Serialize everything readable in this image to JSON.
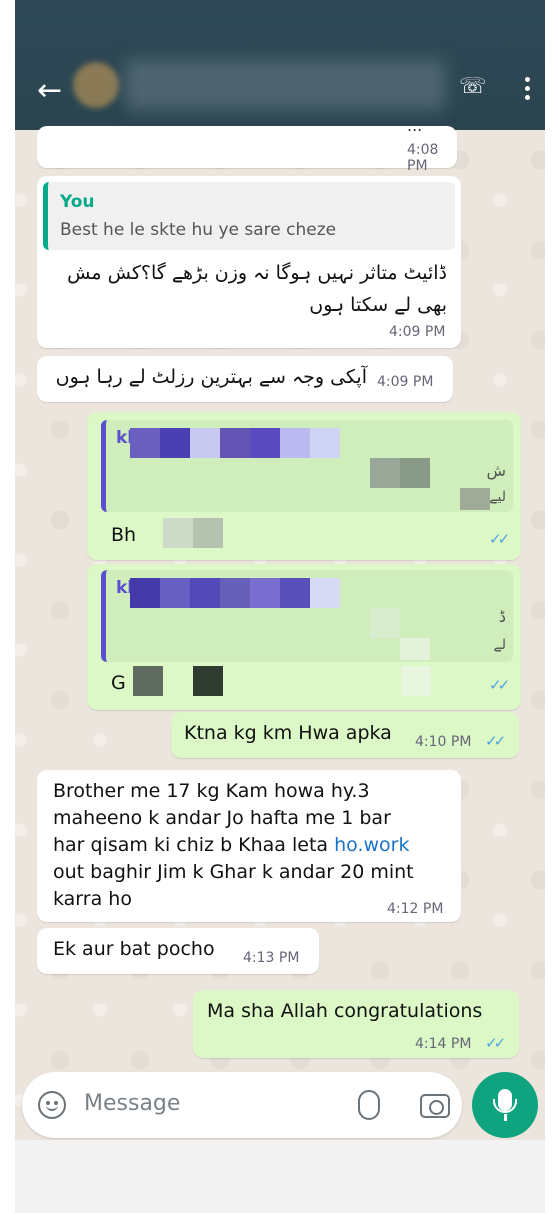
{
  "header": {
    "back_glyph": "←",
    "call_glyph": "☏",
    "partial_status": "..."
  },
  "messages": {
    "m1": {
      "partial_text": "...",
      "time": "4:08 PM"
    },
    "m2": {
      "quote_author": "You",
      "quote_text": "Best he le skte hu ye sare cheze",
      "text_line1": "ڈائیٹ متاثر نہیں ہوگا نہ وزن بڑھے گا؟کش مش",
      "text_line2": "بھی لے سکتا ہوں",
      "time": "4:09 PM"
    },
    "m3": {
      "text": "آپکی وجہ سے بہترین رزلٹ لے رہا ہوں",
      "time": "4:09 PM"
    },
    "m4": {
      "quote_prefix": "kl",
      "quote_urdu_1": "ش",
      "quote_urdu_2": "لیے",
      "text_prefix": "Bh",
      "ticks": "✓✓"
    },
    "m5": {
      "quote_prefix": "kl",
      "quote_urdu_1": "ڈ",
      "quote_urdu_2": "لے",
      "text_prefix": "G",
      "ticks": "✓✓"
    },
    "m6": {
      "text": "Ktna kg km Hwa apka",
      "time": "4:10 PM",
      "ticks": "✓✓"
    },
    "m7": {
      "line1": "Brother me 17 kg Kam howa hy.3",
      "line2": "maheeno k andar Jo hafta me 1 bar",
      "line3_a": "har qisam ki chiz b Khaa leta ",
      "line3_link": "ho.work",
      "line4": "out baghir Jim k Ghar k andar 20 mint",
      "line5": "karra ho",
      "time": "4:12 PM"
    },
    "m8": {
      "text": "Ek aur bat pocho",
      "time": "4:13 PM"
    },
    "m9": {
      "text": "Ma sha Allah congratulations",
      "time": "4:14 PM",
      "ticks": "✓✓"
    }
  },
  "composer": {
    "placeholder": "Message"
  },
  "colors": {
    "header": "#2c4752",
    "outgoing": "#dcf8c6",
    "incoming": "#ffffff",
    "accent": "#0fa37f",
    "tick": "#4fa4e0"
  },
  "icons": [
    "back-arrow-icon",
    "avatar",
    "add-call-icon",
    "more-vert-icon",
    "emoji-icon",
    "attach-icon",
    "camera-icon",
    "mic-icon"
  ]
}
